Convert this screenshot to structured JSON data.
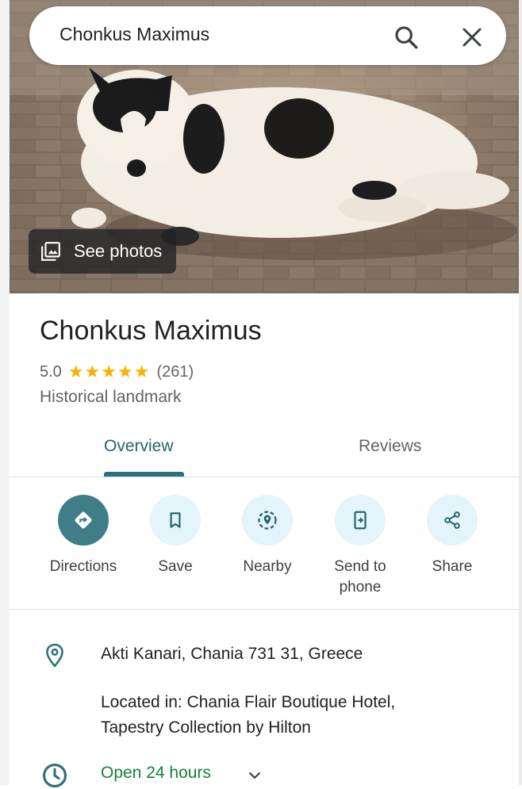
{
  "search": {
    "query": "Chonkus Maximus"
  },
  "hero": {
    "see_photos_label": "See photos"
  },
  "place": {
    "title": "Chonkus Maximus",
    "rating": "5.0",
    "stars": "★★★★★",
    "review_count": "(261)",
    "category": "Historical landmark"
  },
  "tabs": [
    {
      "label": "Overview",
      "active": true
    },
    {
      "label": "Reviews",
      "active": false
    }
  ],
  "actions": [
    {
      "label": "Directions",
      "icon": "directions-icon"
    },
    {
      "label": "Save",
      "icon": "bookmark-icon"
    },
    {
      "label": "Nearby",
      "icon": "nearby-icon"
    },
    {
      "label": "Send to phone",
      "icon": "send-to-phone-icon"
    },
    {
      "label": "Share",
      "icon": "share-icon"
    }
  ],
  "details": {
    "address": "Akti Kanari, Chania 731 31, Greece",
    "located_in_line1": "Located in: Chania Flair Boutique Hotel,",
    "located_in_line2": "Tapestry Collection by Hilton",
    "hours": "Open 24 hours"
  },
  "colors": {
    "accent": "#3f7d89",
    "tab_active": "#23636f",
    "open_green": "#188038",
    "star": "#f4b400",
    "action_bg": "#e3f4fb"
  }
}
